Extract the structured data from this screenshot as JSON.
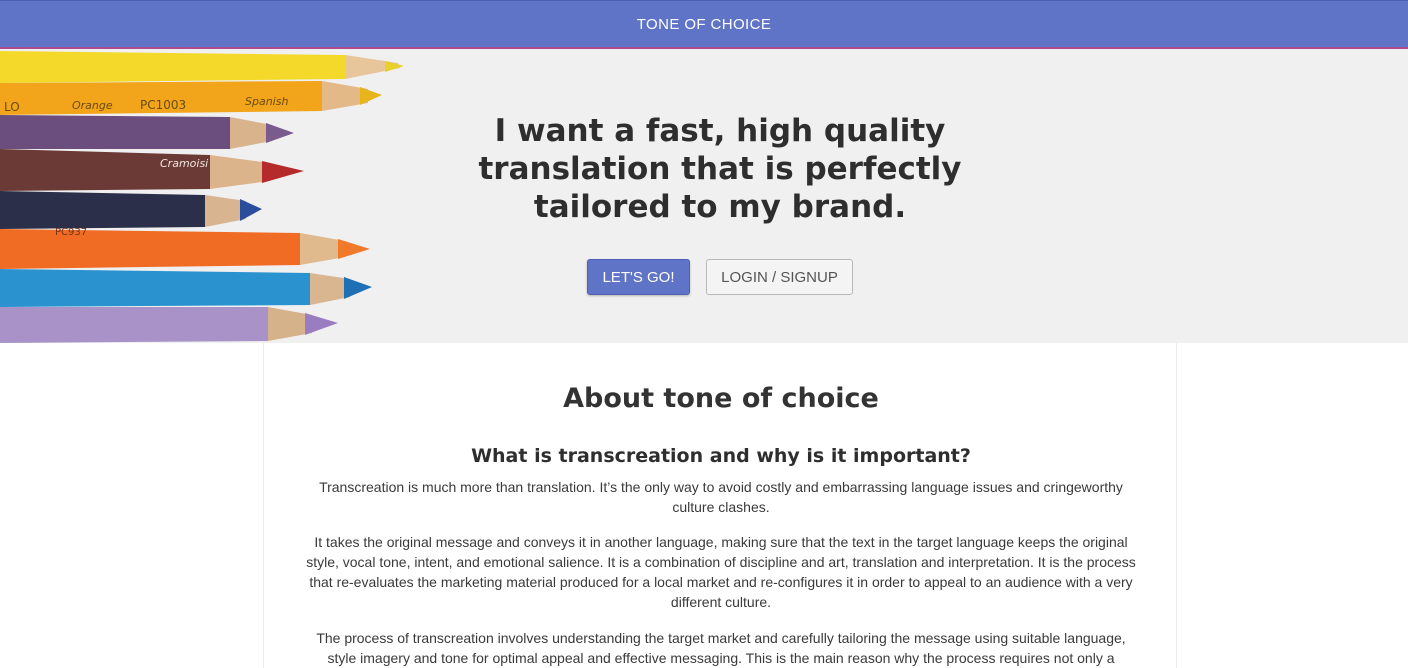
{
  "navbar": {
    "brand": "TONE OF CHOICE",
    "background": "#5f73c7",
    "accent_line": "#b04a8e"
  },
  "hero": {
    "headline_lines": [
      "I want a fast, high quality",
      "translation that is perfectly",
      "tailored to my brand."
    ],
    "primary_button": "LET'S GO!",
    "secondary_button": "LOGIN / SIGNUP",
    "image": "colored-pencils-image",
    "pencil_labels": [
      "LO",
      "Orange",
      "PC1003",
      "Spanish",
      "Cramoisi",
      "PC937"
    ]
  },
  "about": {
    "title": "About tone of choice",
    "subtitle": "What is transcreation and why is it important?",
    "paragraphs": [
      "Transcreation is much more than translation. It’s the only way to avoid costly and embarrassing language issues and cringeworthy culture clashes.",
      "It takes the original message and conveys it in another language, making sure that the text in the target language keeps the original style, vocal tone, intent, and emotional salience. It is a combination of discipline and art, translation and interpretation. It is the process that re-evaluates the marketing material produced for a local market and re-configures it in order to appeal to an audience with a very different culture.",
      "The process of transcreation involves understanding the target market and carefully tailoring the message using suitable language, style imagery and tone for optimal appeal and effective messaging. This is the main reason why the process requires not only a"
    ]
  }
}
